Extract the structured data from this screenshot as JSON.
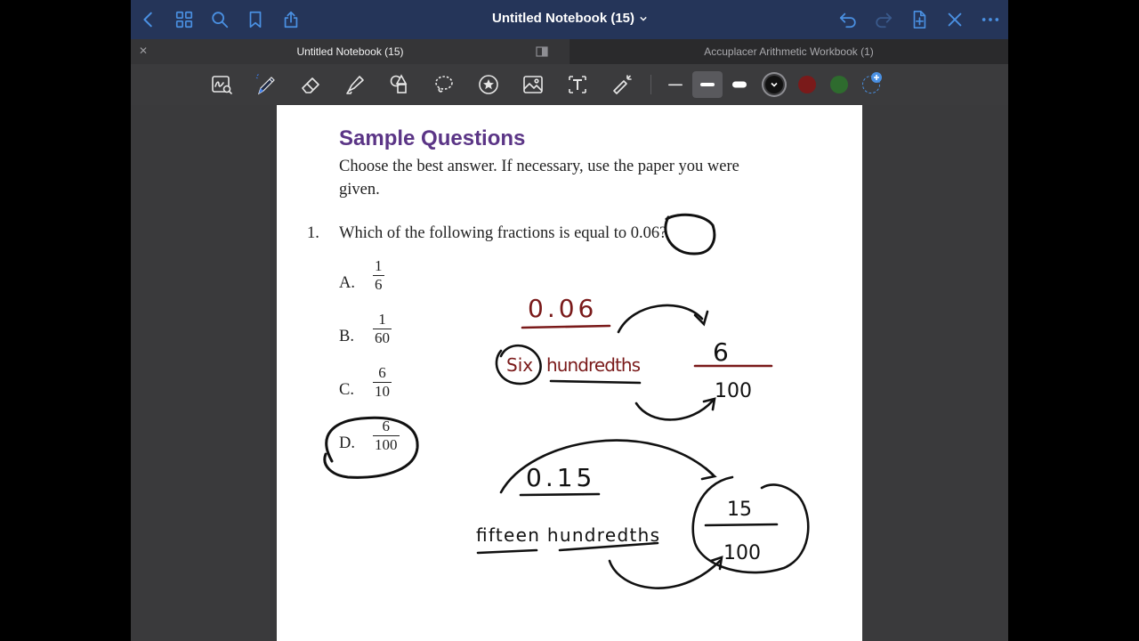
{
  "navbar": {
    "title": "Untitled Notebook (15)",
    "left_icons": [
      "back-chevron-icon",
      "grid-icon",
      "search-icon",
      "bookmark-icon",
      "share-icon"
    ],
    "right_icons": [
      "undo-icon",
      "redo-icon",
      "add-page-icon",
      "close-icon",
      "more-icon"
    ]
  },
  "tabs": [
    {
      "label": "Untitled Notebook (15)",
      "active": true
    },
    {
      "label": "Accuplacer Arithmetic Workbook (1)",
      "active": false
    }
  ],
  "toolbar": {
    "tools": [
      "zoom-window-icon",
      "pen-icon",
      "eraser-icon",
      "highlighter-icon",
      "shapes-icon",
      "lasso-icon",
      "elements-icon",
      "image-icon",
      "text-icon",
      "laser-pointer-icon"
    ],
    "widths": [
      "thin",
      "medium",
      "thick"
    ],
    "selected_width": "medium",
    "colors": [
      "#111111",
      "#7a1a1a",
      "#2e7d32"
    ],
    "selected_color": "#111111",
    "accent": "#3b82f6"
  },
  "page": {
    "heading": "Sample Questions",
    "instructions": "Choose the best answer. If necessary, use the paper you were given.",
    "question": {
      "number": "1.",
      "text": "Which of the following fractions is equal to 0.06?"
    },
    "choices": [
      {
        "letter": "A.",
        "numerator": "1",
        "denominator": "6"
      },
      {
        "letter": "B.",
        "numerator": "1",
        "denominator": "60"
      },
      {
        "letter": "C.",
        "numerator": "6",
        "denominator": "10"
      },
      {
        "letter": "D.",
        "numerator": "6",
        "denominator": "100"
      }
    ]
  },
  "handwriting": {
    "dec1": "0.06",
    "six": "Six",
    "hundredths1": "hundredths",
    "num1": "6",
    "den1": "100",
    "dec2": "0.15",
    "words2": "fifteen hundredths",
    "num2": "15",
    "den2": "100",
    "red": "#7a1a1a",
    "black": "#111111"
  }
}
